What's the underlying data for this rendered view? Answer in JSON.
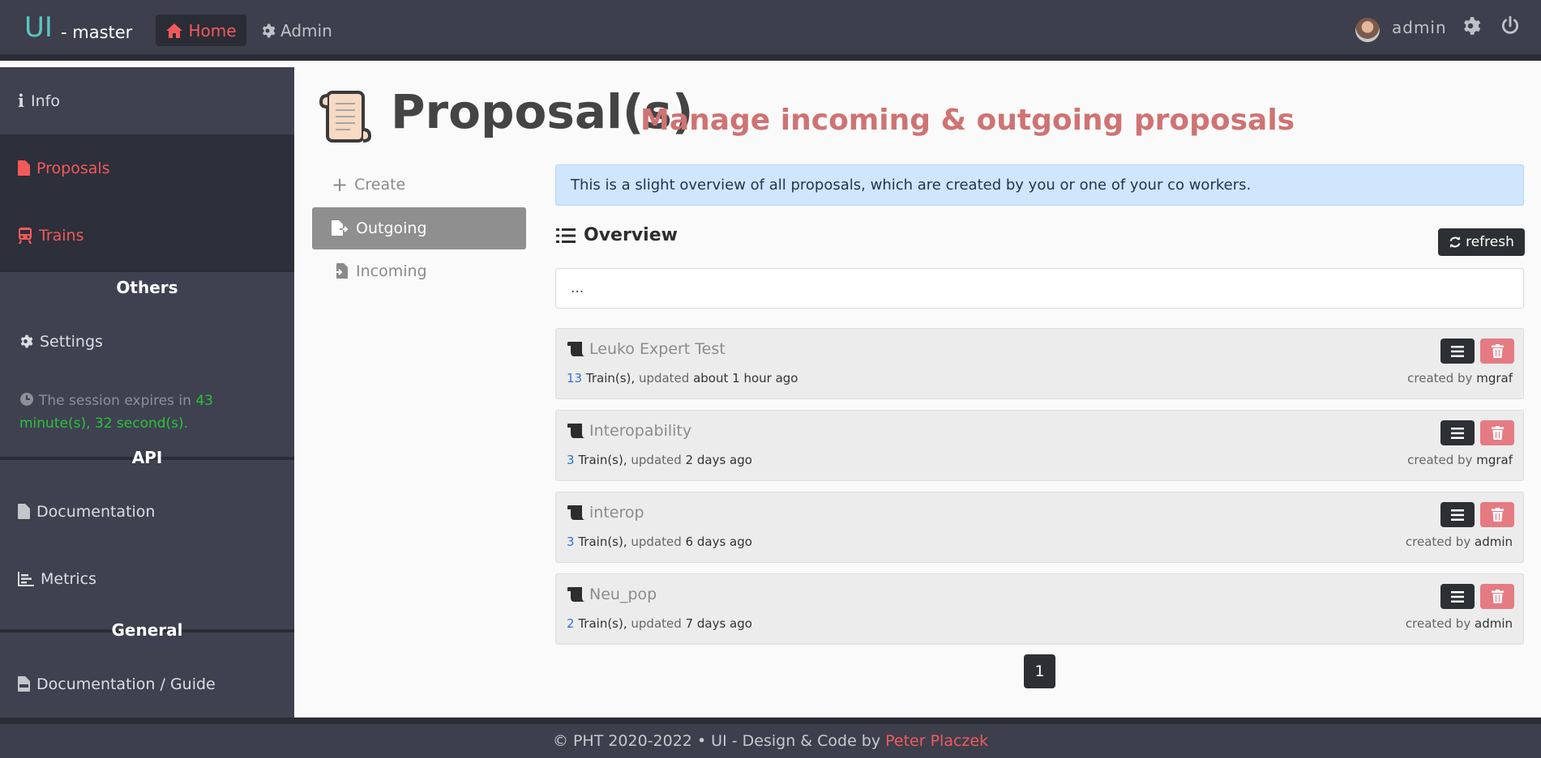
{
  "topbar": {
    "brand": "UI",
    "brand_sub": "- master",
    "nav": {
      "home": "Home",
      "admin": "Admin"
    },
    "user_name": "admin"
  },
  "sidebar": {
    "info": "Info",
    "proposals": "Proposals",
    "trains": "Trains",
    "others_heading": "Others",
    "settings": "Settings",
    "session_prefix": "The session expires in",
    "session_time": "43 minute(s), 32 second(s).",
    "api_heading": "API",
    "documentation": "Documentation",
    "metrics": "Metrics",
    "general_heading": "General",
    "guide": "Documentation / Guide"
  },
  "page": {
    "title": "Proposal(s)",
    "subtitle": "Manage incoming & outgoing proposals"
  },
  "subnav": {
    "create": "Create",
    "outgoing": "Outgoing",
    "incoming": "Incoming"
  },
  "alert": "This is a slight overview of all proposals, which are created by you or one of your co workers.",
  "overview": {
    "title": "Overview",
    "refresh": "refresh",
    "search_value": "..."
  },
  "proposals": [
    {
      "name": "Leuko Expert Test",
      "trains": "13",
      "trains_label": "Train(s),",
      "updated_label": "updated",
      "updated": "about 1 hour ago",
      "created_label": "created by",
      "creator": "mgraf"
    },
    {
      "name": "Interopability",
      "trains": "3",
      "trains_label": "Train(s),",
      "updated_label": "updated",
      "updated": "2 days ago",
      "created_label": "created by",
      "creator": "mgraf"
    },
    {
      "name": "interop",
      "trains": "3",
      "trains_label": "Train(s),",
      "updated_label": "updated",
      "updated": "6 days ago",
      "created_label": "created by",
      "creator": "admin"
    },
    {
      "name": "Neu_pop",
      "trains": "2",
      "trains_label": "Train(s),",
      "updated_label": "updated",
      "updated": "7 days ago",
      "created_label": "created by",
      "creator": "admin"
    }
  ],
  "pagination": {
    "current": "1"
  },
  "footer": {
    "text": "© PHT 2020-2022 • UI - Design & Code by",
    "author": "Peter Placzek"
  },
  "colors": {
    "accent_red": "#f25a5a",
    "teal_brand": "#5bc4c2",
    "dark_nav": "#3d3f4c",
    "session_green": "#29c33b"
  }
}
